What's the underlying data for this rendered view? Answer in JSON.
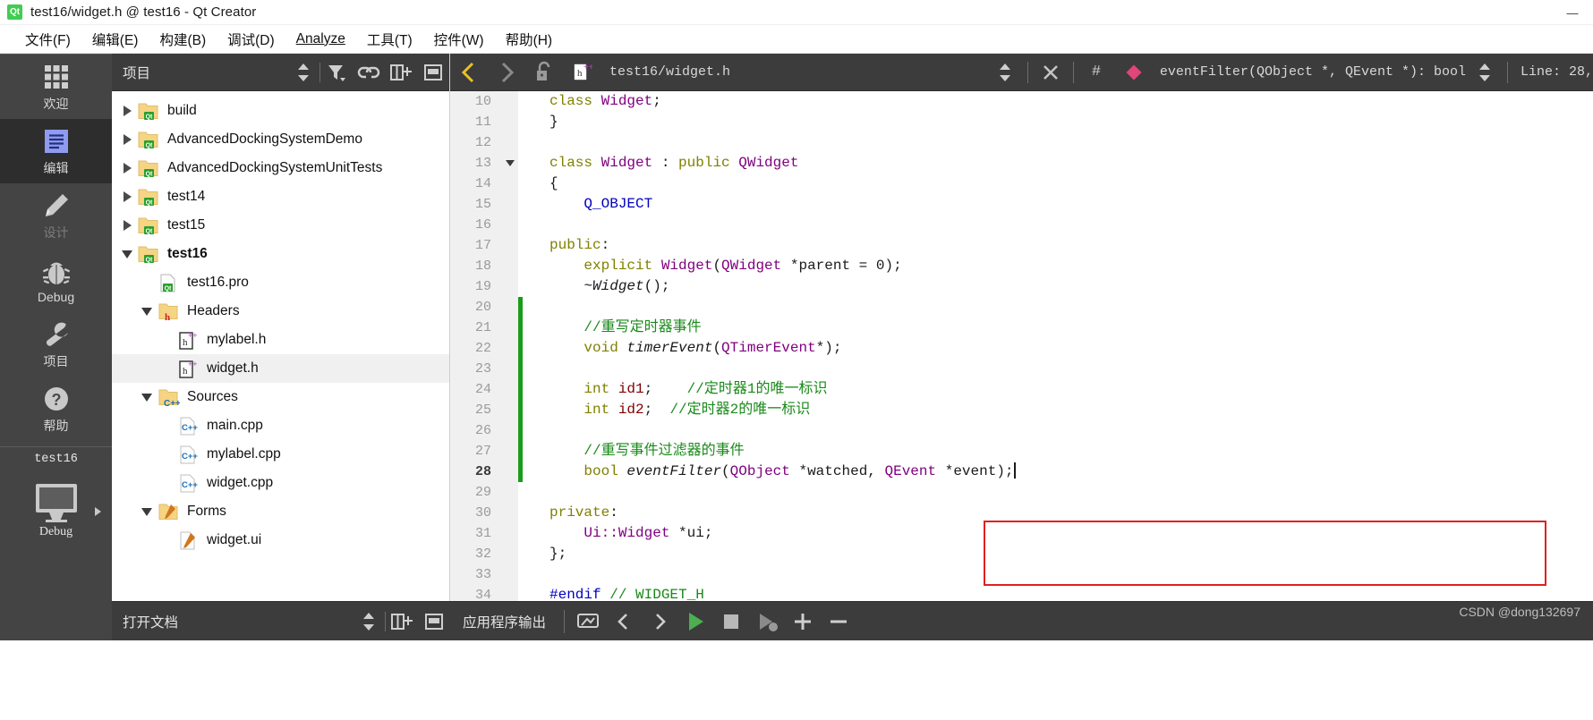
{
  "window": {
    "title": "test16/widget.h @ test16 - Qt Creator",
    "app_icon": "qt-logo-icon",
    "minimize_label": "—",
    "maximize_label": "□",
    "close_label": "✕"
  },
  "menubar": {
    "items": [
      {
        "label": "文件(F)",
        "mnemonic": "F"
      },
      {
        "label": "编辑(E)",
        "mnemonic": "E"
      },
      {
        "label": "构建(B)",
        "mnemonic": "B"
      },
      {
        "label": "调试(D)",
        "mnemonic": "D"
      },
      {
        "label": "Analyze",
        "mnemonic": "A"
      },
      {
        "label": "工具(T)",
        "mnemonic": "T"
      },
      {
        "label": "控件(W)",
        "mnemonic": "W"
      },
      {
        "label": "帮助(H)",
        "mnemonic": "H"
      }
    ]
  },
  "modebar": {
    "modes": [
      {
        "label": "欢迎",
        "icon": "grid-icon",
        "state": "normal"
      },
      {
        "label": "编辑",
        "icon": "edit-document-icon",
        "state": "active"
      },
      {
        "label": "设计",
        "icon": "pencil-icon",
        "state": "disabled"
      },
      {
        "label": "Debug",
        "icon": "bug-icon",
        "state": "normal"
      },
      {
        "label": "项目",
        "icon": "wrench-icon",
        "state": "normal"
      },
      {
        "label": "帮助",
        "icon": "question-mark-icon",
        "state": "normal"
      }
    ],
    "kit": {
      "project_name": "test16",
      "build_config": "Debug",
      "desktop_icon": "monitor-icon",
      "expand_icon": "chevron-right-icon",
      "run_icon": "run-triangle-icon"
    }
  },
  "project_panel": {
    "title": "项目",
    "toolbar_icons": [
      "sync-updown-icon",
      "filter-icon",
      "link-icon",
      "split-add-icon",
      "collapse-icon"
    ],
    "tree": [
      {
        "label": "build",
        "depth": 0,
        "arrow": "right",
        "icon": "qt-folder-icon",
        "selected": false,
        "bold": false
      },
      {
        "label": "AdvancedDockingSystemDemo",
        "depth": 0,
        "arrow": "right",
        "icon": "qt-folder-icon",
        "selected": false,
        "bold": false
      },
      {
        "label": "AdvancedDockingSystemUnitTests",
        "depth": 0,
        "arrow": "right",
        "icon": "qt-folder-icon",
        "selected": false,
        "bold": false
      },
      {
        "label": "test14",
        "depth": 0,
        "arrow": "right",
        "icon": "qt-folder-icon",
        "selected": false,
        "bold": false
      },
      {
        "label": "test15",
        "depth": 0,
        "arrow": "right",
        "icon": "qt-folder-icon",
        "selected": false,
        "bold": false
      },
      {
        "label": "test16",
        "depth": 0,
        "arrow": "down",
        "icon": "qt-folder-icon",
        "selected": false,
        "bold": true
      },
      {
        "label": "test16.pro",
        "depth": 1,
        "arrow": "none",
        "icon": "qt-pro-file-icon",
        "selected": false,
        "bold": false
      },
      {
        "label": "Headers",
        "depth": 1,
        "arrow": "down",
        "icon": "headers-folder-icon",
        "selected": false,
        "bold": false
      },
      {
        "label": "mylabel.h",
        "depth": 2,
        "arrow": "none",
        "icon": "hpp-file-icon",
        "selected": false,
        "bold": false
      },
      {
        "label": "widget.h",
        "depth": 2,
        "arrow": "none",
        "icon": "hpp-file-icon",
        "selected": true,
        "bold": false
      },
      {
        "label": "Sources",
        "depth": 1,
        "arrow": "down",
        "icon": "sources-folder-icon",
        "selected": false,
        "bold": false
      },
      {
        "label": "main.cpp",
        "depth": 2,
        "arrow": "none",
        "icon": "cpp-file-icon",
        "selected": false,
        "bold": false
      },
      {
        "label": "mylabel.cpp",
        "depth": 2,
        "arrow": "none",
        "icon": "cpp-file-icon",
        "selected": false,
        "bold": false
      },
      {
        "label": "widget.cpp",
        "depth": 2,
        "arrow": "none",
        "icon": "cpp-file-icon",
        "selected": false,
        "bold": false
      },
      {
        "label": "Forms",
        "depth": 1,
        "arrow": "down",
        "icon": "forms-folder-icon",
        "selected": false,
        "bold": false
      },
      {
        "label": "widget.ui",
        "depth": 2,
        "arrow": "none",
        "icon": "ui-file-icon",
        "selected": false,
        "bold": false
      }
    ]
  },
  "open_documents_bar": {
    "title": "打开文档",
    "icons": [
      "sync-updown-icon",
      "split-add-icon",
      "collapse-icon"
    ]
  },
  "editor_toolbar": {
    "back_label": "‹",
    "forward_label": "›",
    "lock_icon": "unlock-icon",
    "file_icon": "hpp-file-icon",
    "file_path": "test16/widget.h",
    "updown_icon": "sync-updown-icon",
    "close_label": "✕",
    "hash_label": "#",
    "symbol_icon": "method-diamond-icon",
    "symbol_text": "eventFilter(QObject *, QEvent *): bool",
    "line_info": "Line: 28,"
  },
  "editor": {
    "current_line": 28,
    "red_annotation_box": true,
    "lines": [
      {
        "num": 10,
        "fold": false,
        "changed": false,
        "tokens": [
          {
            "t": "class ",
            "c": "k"
          },
          {
            "t": "Widget",
            "c": "ty"
          },
          {
            "t": ";",
            "c": "nm"
          }
        ]
      },
      {
        "num": 11,
        "fold": false,
        "changed": false,
        "tokens": [
          {
            "t": "}",
            "c": "nm"
          }
        ]
      },
      {
        "num": 12,
        "fold": false,
        "changed": false,
        "tokens": []
      },
      {
        "num": 13,
        "fold": true,
        "changed": false,
        "tokens": [
          {
            "t": "class ",
            "c": "k"
          },
          {
            "t": "Widget",
            "c": "ty"
          },
          {
            "t": " : ",
            "c": "nm"
          },
          {
            "t": "public ",
            "c": "k"
          },
          {
            "t": "QWidget",
            "c": "ty"
          }
        ]
      },
      {
        "num": 14,
        "fold": false,
        "changed": false,
        "tokens": [
          {
            "t": "{",
            "c": "nm"
          }
        ]
      },
      {
        "num": 15,
        "fold": false,
        "changed": false,
        "tokens": [
          {
            "t": "    ",
            "c": "nm"
          },
          {
            "t": "Q_OBJECT",
            "c": "mc"
          }
        ]
      },
      {
        "num": 16,
        "fold": false,
        "changed": false,
        "tokens": []
      },
      {
        "num": 17,
        "fold": false,
        "changed": false,
        "tokens": [
          {
            "t": "public",
            "c": "k"
          },
          {
            "t": ":",
            "c": "nm"
          }
        ]
      },
      {
        "num": 18,
        "fold": false,
        "changed": false,
        "tokens": [
          {
            "t": "    ",
            "c": "nm"
          },
          {
            "t": "explicit ",
            "c": "k"
          },
          {
            "t": "Widget",
            "c": "ty"
          },
          {
            "t": "(",
            "c": "nm"
          },
          {
            "t": "QWidget",
            "c": "ty"
          },
          {
            "t": " *parent = ",
            "c": "nm"
          },
          {
            "t": "0",
            "c": "num"
          },
          {
            "t": ");",
            "c": "nm"
          }
        ]
      },
      {
        "num": 19,
        "fold": false,
        "changed": false,
        "tokens": [
          {
            "t": "    ",
            "c": "nm"
          },
          {
            "t": "~Widget",
            "c": "fn"
          },
          {
            "t": "();",
            "c": "nm"
          }
        ]
      },
      {
        "num": 20,
        "fold": false,
        "changed": true,
        "tokens": []
      },
      {
        "num": 21,
        "fold": false,
        "changed": true,
        "tokens": [
          {
            "t": "    ",
            "c": "nm"
          },
          {
            "t": "//重写定时器事件",
            "c": "cm"
          }
        ]
      },
      {
        "num": 22,
        "fold": false,
        "changed": true,
        "tokens": [
          {
            "t": "    ",
            "c": "nm"
          },
          {
            "t": "void ",
            "c": "k"
          },
          {
            "t": "timerEvent",
            "c": "fn"
          },
          {
            "t": "(",
            "c": "nm"
          },
          {
            "t": "QTimerEvent",
            "c": "ty"
          },
          {
            "t": "*);",
            "c": "nm"
          }
        ]
      },
      {
        "num": 23,
        "fold": false,
        "changed": true,
        "tokens": []
      },
      {
        "num": 24,
        "fold": false,
        "changed": true,
        "tokens": [
          {
            "t": "    ",
            "c": "nm"
          },
          {
            "t": "int ",
            "c": "k"
          },
          {
            "t": "id1",
            "c": "mv"
          },
          {
            "t": ";    ",
            "c": "nm"
          },
          {
            "t": "//定时器1的唯一标识",
            "c": "cm"
          }
        ]
      },
      {
        "num": 25,
        "fold": false,
        "changed": true,
        "tokens": [
          {
            "t": "    ",
            "c": "nm"
          },
          {
            "t": "int ",
            "c": "k"
          },
          {
            "t": "id2",
            "c": "mv"
          },
          {
            "t": ";  ",
            "c": "nm"
          },
          {
            "t": "//定时器2的唯一标识",
            "c": "cm"
          }
        ]
      },
      {
        "num": 26,
        "fold": false,
        "changed": true,
        "tokens": []
      },
      {
        "num": 27,
        "fold": false,
        "changed": true,
        "tokens": [
          {
            "t": "    ",
            "c": "nm"
          },
          {
            "t": "//重写事件过滤器的事件",
            "c": "cm"
          }
        ]
      },
      {
        "num": 28,
        "fold": false,
        "changed": true,
        "current": true,
        "caret": true,
        "tokens": [
          {
            "t": "    ",
            "c": "nm"
          },
          {
            "t": "bool ",
            "c": "k"
          },
          {
            "t": "eventFilter",
            "c": "fn"
          },
          {
            "t": "(",
            "c": "nm"
          },
          {
            "t": "QObject",
            "c": "ty"
          },
          {
            "t": " *watched, ",
            "c": "nm"
          },
          {
            "t": "QEvent",
            "c": "ty"
          },
          {
            "t": " *event);",
            "c": "nm"
          }
        ]
      },
      {
        "num": 29,
        "fold": false,
        "changed": false,
        "tokens": []
      },
      {
        "num": 30,
        "fold": false,
        "changed": false,
        "tokens": [
          {
            "t": "private",
            "c": "k"
          },
          {
            "t": ":",
            "c": "nm"
          }
        ]
      },
      {
        "num": 31,
        "fold": false,
        "changed": false,
        "tokens": [
          {
            "t": "    ",
            "c": "nm"
          },
          {
            "t": "Ui::Widget",
            "c": "ty"
          },
          {
            "t": " *ui;",
            "c": "nm"
          }
        ]
      },
      {
        "num": 32,
        "fold": false,
        "changed": false,
        "tokens": [
          {
            "t": "};",
            "c": "nm"
          }
        ]
      },
      {
        "num": 33,
        "fold": false,
        "changed": false,
        "tokens": []
      },
      {
        "num": 34,
        "fold": false,
        "changed": false,
        "tokens": [
          {
            "t": "#endif ",
            "c": "mc"
          },
          {
            "t": "// WIDGET_H",
            "c": "cm"
          }
        ]
      }
    ]
  },
  "bottom_bar": {
    "output_label": "应用程序输出",
    "buttons": [
      {
        "name": "output-settings-icon",
        "label": ""
      },
      {
        "name": "prev-item-icon",
        "label": "‹"
      },
      {
        "name": "next-item-icon",
        "label": "›"
      },
      {
        "name": "run-icon",
        "label": ""
      },
      {
        "name": "stop-icon",
        "label": ""
      },
      {
        "name": "run-debug-icon",
        "label": ""
      },
      {
        "name": "zoom-in-icon",
        "label": "+"
      },
      {
        "name": "zoom-out-icon",
        "label": "−"
      }
    ]
  },
  "watermark": {
    "text": "CSDN @dong132697"
  },
  "colors": {
    "panel_dark": "#3c3c3c",
    "modebar": "#444444",
    "mode_active": "#2d2d2d",
    "accent_green": "#41cd52",
    "run_green": "#4caf50",
    "annotation_red": "#e02020",
    "change_bar_green": "#1a9c1a",
    "symbol_pink": "#e0457b",
    "back_arrow_gold": "#e8c027"
  }
}
